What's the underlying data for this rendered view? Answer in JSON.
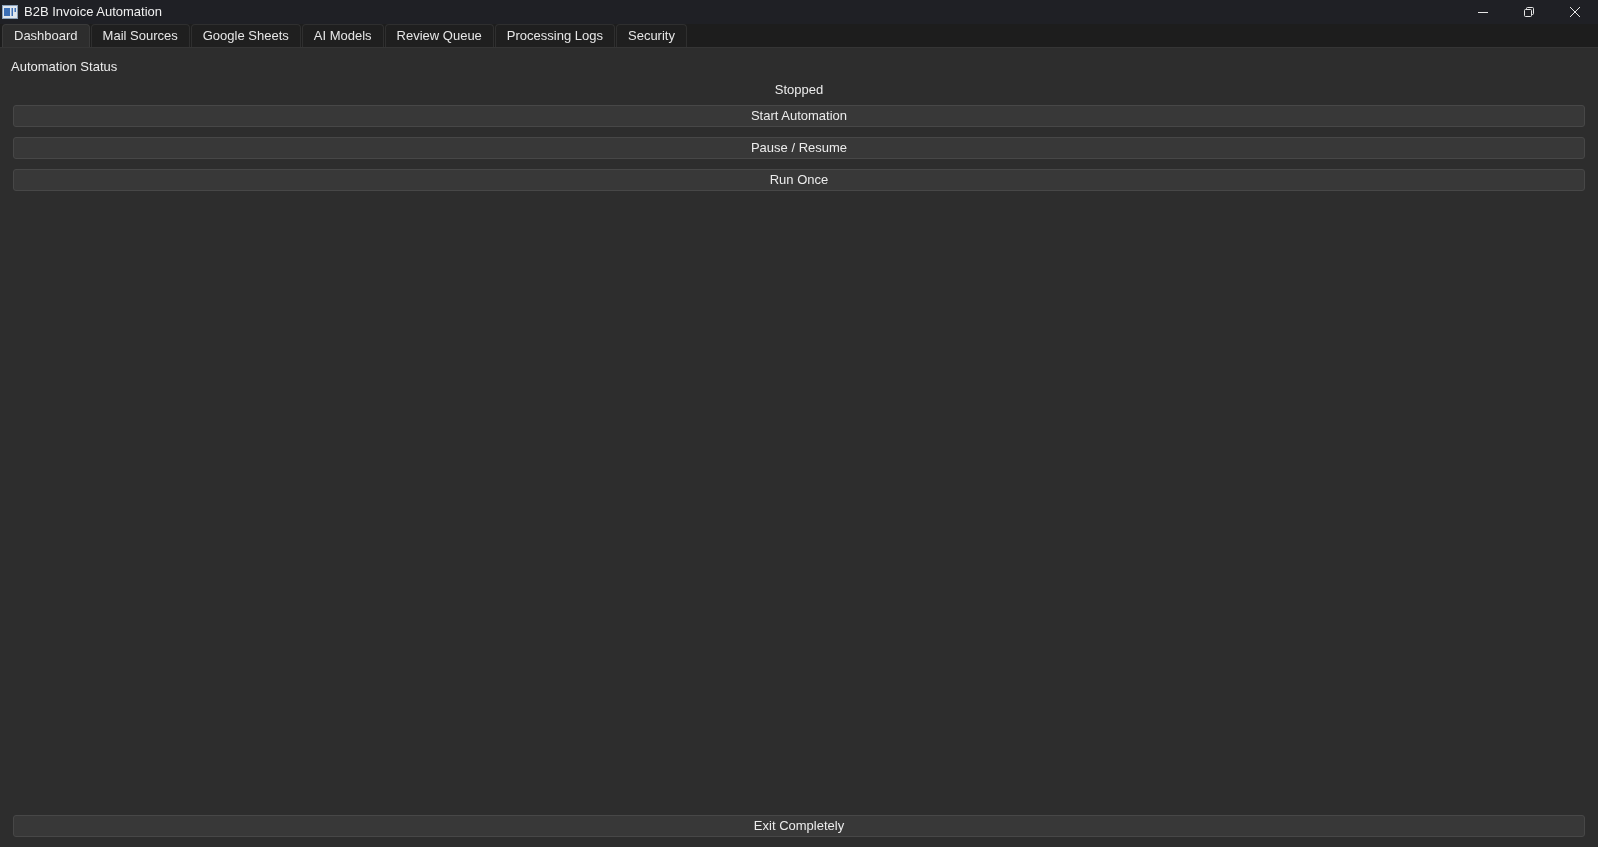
{
  "window": {
    "title": "B2B Invoice Automation"
  },
  "tabs": [
    {
      "label": "Dashboard",
      "selected": true
    },
    {
      "label": "Mail Sources",
      "selected": false
    },
    {
      "label": "Google Sheets",
      "selected": false
    },
    {
      "label": "AI Models",
      "selected": false
    },
    {
      "label": "Review Queue",
      "selected": false
    },
    {
      "label": "Processing Logs",
      "selected": false
    },
    {
      "label": "Security",
      "selected": false
    }
  ],
  "dashboard": {
    "status_label": "Automation Status",
    "status": "Stopped",
    "buttons": [
      "Start Automation",
      "Pause / Resume",
      "Run Once"
    ],
    "exit_button": "Exit Completely"
  }
}
